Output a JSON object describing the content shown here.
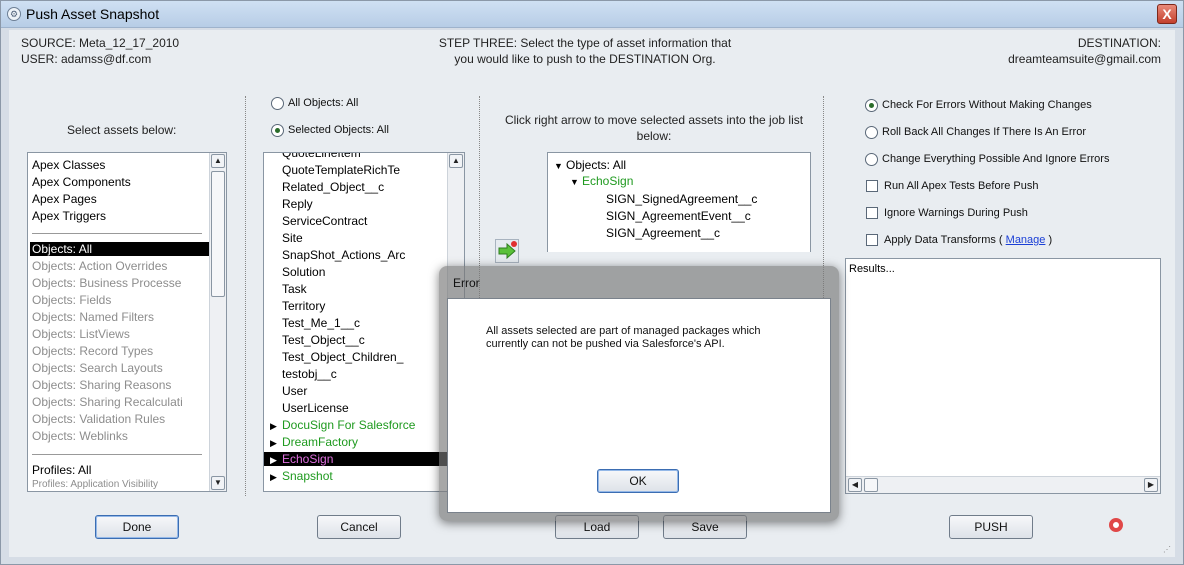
{
  "window": {
    "title": "Push Asset Snapshot",
    "close_glyph": "X"
  },
  "header": {
    "source": "SOURCE: Meta_12_17_2010",
    "user": "USER: adamss@df.com",
    "step_line1": "STEP THREE: Select the type of asset information that",
    "step_line2": "you would like to push to the DESTINATION Org.",
    "destination_label": "DESTINATION:",
    "destination_value": "dreamteamsuite@gmail.com"
  },
  "asset_panel": {
    "heading": "Select assets below:",
    "top_items": [
      "Apex Classes",
      "Apex Components",
      "Apex Pages",
      "Apex Triggers"
    ],
    "selected_item": "Objects: All",
    "object_items": [
      "Objects: Action Overrides",
      "Objects: Business Processe",
      "Objects: Fields",
      "Objects: Named Filters",
      "Objects: ListViews",
      "Objects: Record Types",
      "Objects: Search Layouts",
      "Objects: Sharing Reasons",
      "Objects: Sharing Recalculati",
      "Objects: Validation Rules",
      "Objects: Weblinks"
    ],
    "profiles_item": "Profiles: All",
    "profiles_partial": "Profiles: Application Visibility"
  },
  "objects_panel": {
    "radio_all": "All Objects: All",
    "radio_selected": "Selected Objects: All",
    "partial_top": "QuoteLineItem",
    "items": [
      "QuoteTemplateRichTe",
      "Related_Object__c",
      "Reply",
      "ServiceContract",
      "Site",
      "SnapShot_Actions_Arc",
      "Solution",
      "Task",
      "Territory",
      "Test_Me_1__c",
      "Test_Object__c",
      "Test_Object_Children_",
      "testobj__c",
      "User",
      "UserLicense"
    ],
    "packages": [
      "DocuSign For Salesforce",
      "DreamFactory",
      "EchoSign",
      "Snapshot"
    ]
  },
  "job_panel": {
    "instructions": "Click right arrow to move selected assets into the job list below:",
    "tree_root": "Objects: All",
    "tree_package": "EchoSign",
    "tree_items": [
      "SIGN_SignedAgreement__c",
      "SIGN_AgreementEvent__c",
      "SIGN_Agreement__c"
    ]
  },
  "options": {
    "radio1": "Check For Errors Without Making Changes",
    "radio2": "Roll Back All Changes If There Is An Error",
    "radio3": "Change Everything Possible And Ignore Errors",
    "check1": "Run All Apex Tests Before Push",
    "check2": "Ignore Warnings During Push",
    "check3_prefix": "Apply Data Transforms (",
    "check3_link": "Manage",
    "check3_suffix": ")"
  },
  "results": {
    "label": "Results..."
  },
  "buttons": {
    "done": "Done",
    "cancel": "Cancel",
    "load": "Load",
    "save": "Save",
    "push": "PUSH"
  },
  "dialog": {
    "title": "Error",
    "message_line1": "All assets selected are part of managed packages which",
    "message_line2": "currently can not be pushed via Salesforce's API.",
    "ok": "OK"
  },
  "colors": {
    "package_green": "#1f9a1f",
    "package_magenta": "#e070e0",
    "link_blue": "#1a3fd6",
    "radio_dot": "#2a6c2a"
  }
}
